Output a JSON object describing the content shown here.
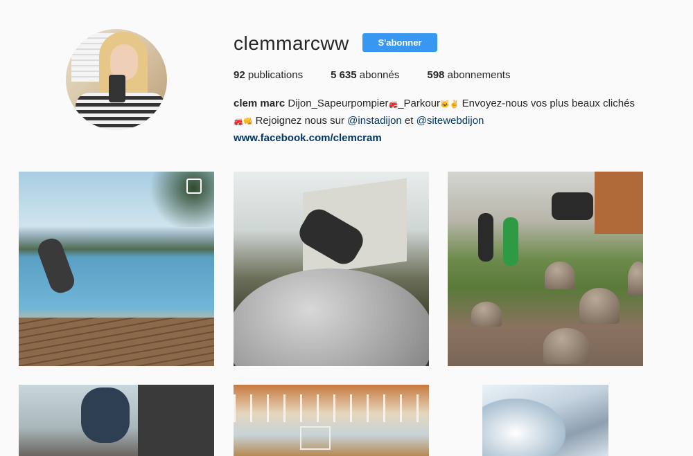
{
  "profile": {
    "username": "clemmarcww",
    "follow_label": "S'abonner"
  },
  "stats": {
    "publications_count": "92",
    "publications_label": "publications",
    "followers_count": "5 635",
    "followers_label": "abonnés",
    "following_count": "598",
    "following_label": "abonnements"
  },
  "bio": {
    "name": "clem marc",
    "line1_text": " Dijon_Sapeurpompier",
    "emoji_truck": "🚒",
    "parkour": "_Parkour",
    "emoji_cat": "🐱",
    "emoji_hand": "✌",
    "line1_rest": " Envoyez-nous vos plus beaux clichés",
    "emoji_truck2": "🚒",
    "emoji_fist": "👊",
    "line2_text": " Rejoignez nous sur ",
    "mention1": "@instadijon",
    "and": " et ",
    "mention2": "@sitewebdijon",
    "website": "www.facebook.com/clemcram"
  }
}
